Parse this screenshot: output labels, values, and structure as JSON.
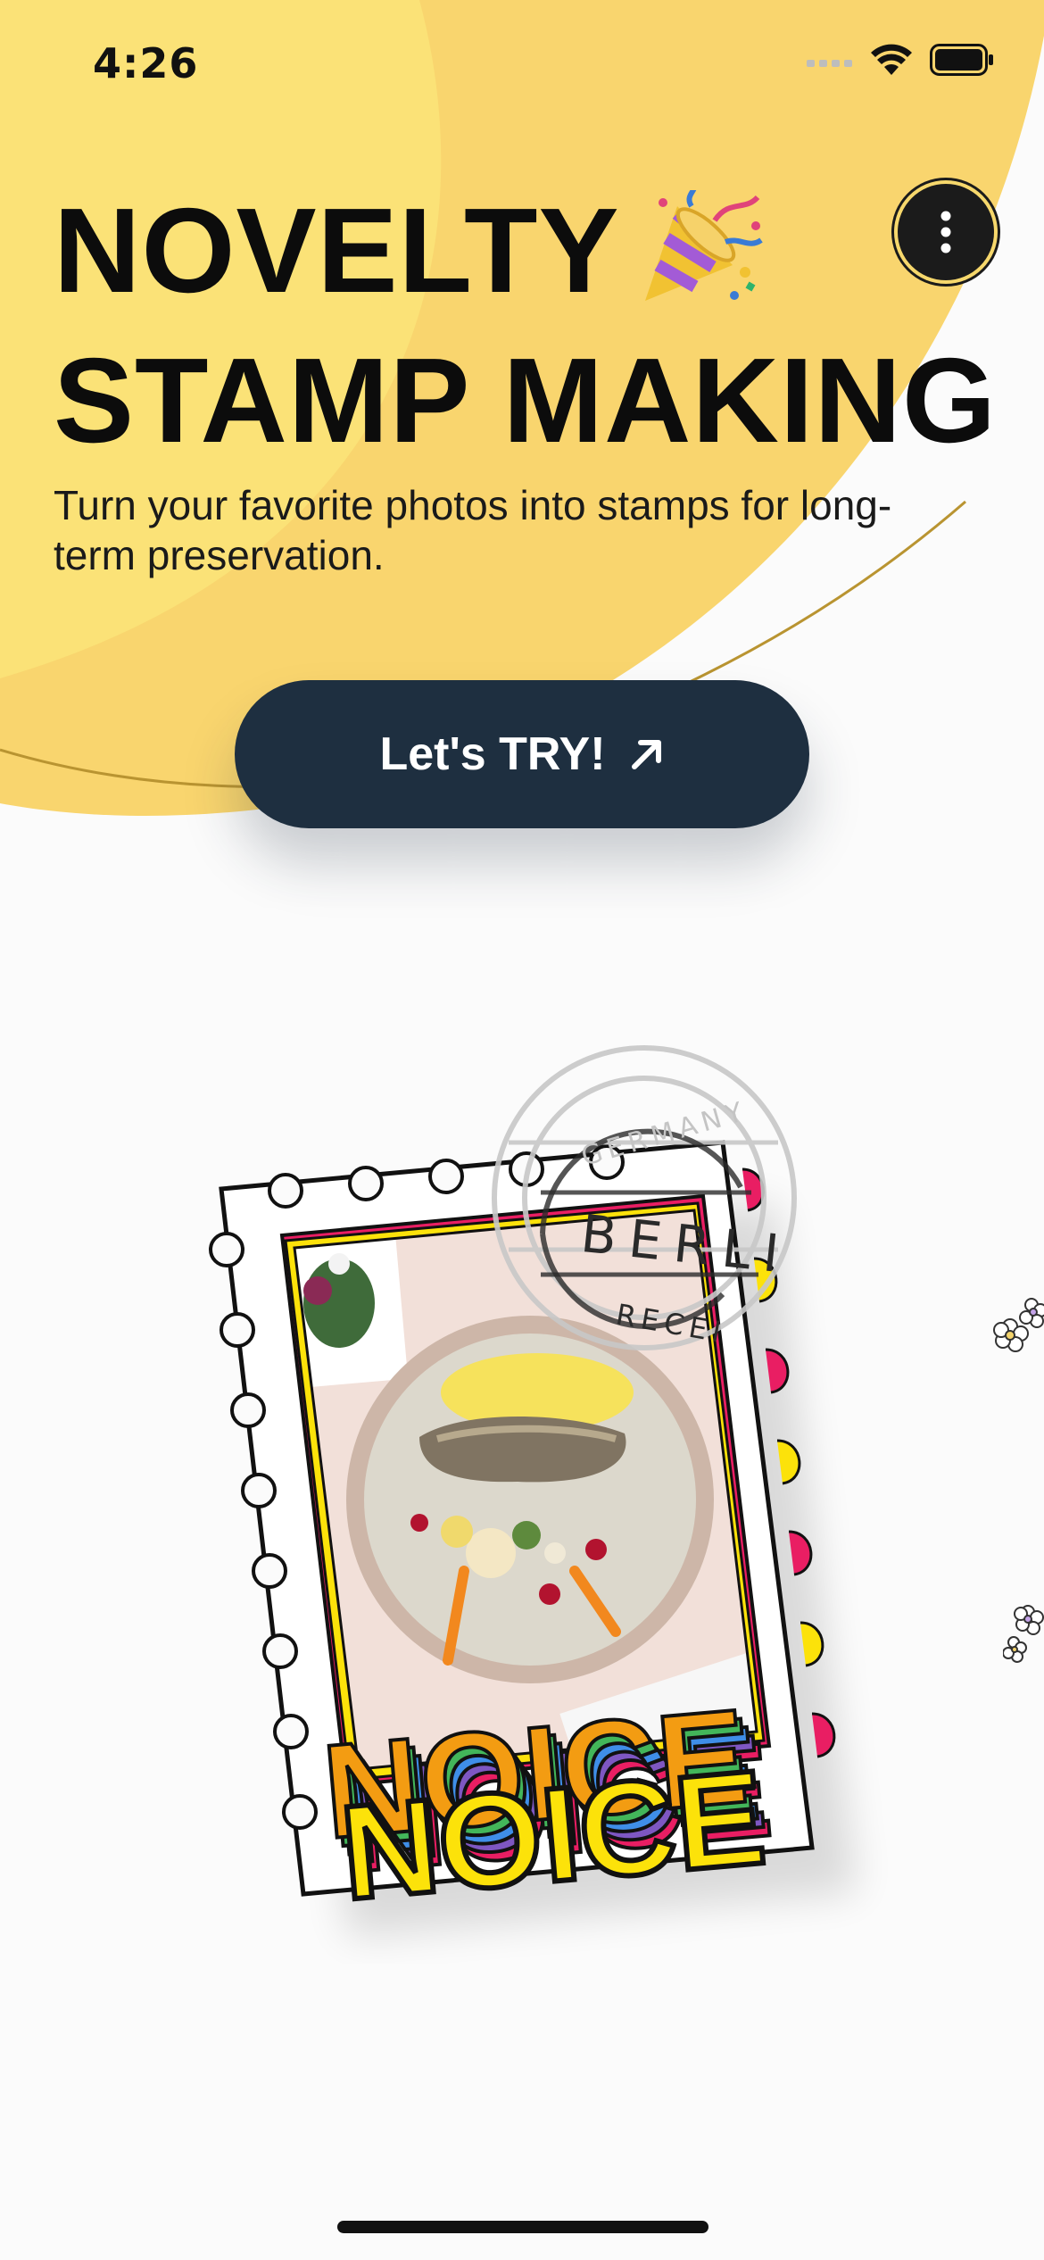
{
  "status_bar": {
    "time": "4:26"
  },
  "header": {
    "title_line1": "NOVELTY",
    "title_line2": "STAMP MAKING",
    "subtitle": "Turn your favorite photos into stamps for long-term preservation."
  },
  "cta": {
    "label": "Let's TRY!"
  },
  "stamp": {
    "sticker_text": "NOICE",
    "postmark_top": "GERMANY",
    "postmark_middle": "BERLI",
    "postmark_bottom": "RECEI"
  },
  "colors": {
    "header_yellow": "#f9d56e",
    "header_yellow_light": "#fbe277",
    "button_navy": "#1e2f40",
    "text_dark": "#0c0c0c",
    "background": "#fbfbfb"
  },
  "icons": {
    "party": "party-popper-icon",
    "menu": "more-vertical-icon",
    "cta_arrow": "arrow-up-right-icon"
  }
}
